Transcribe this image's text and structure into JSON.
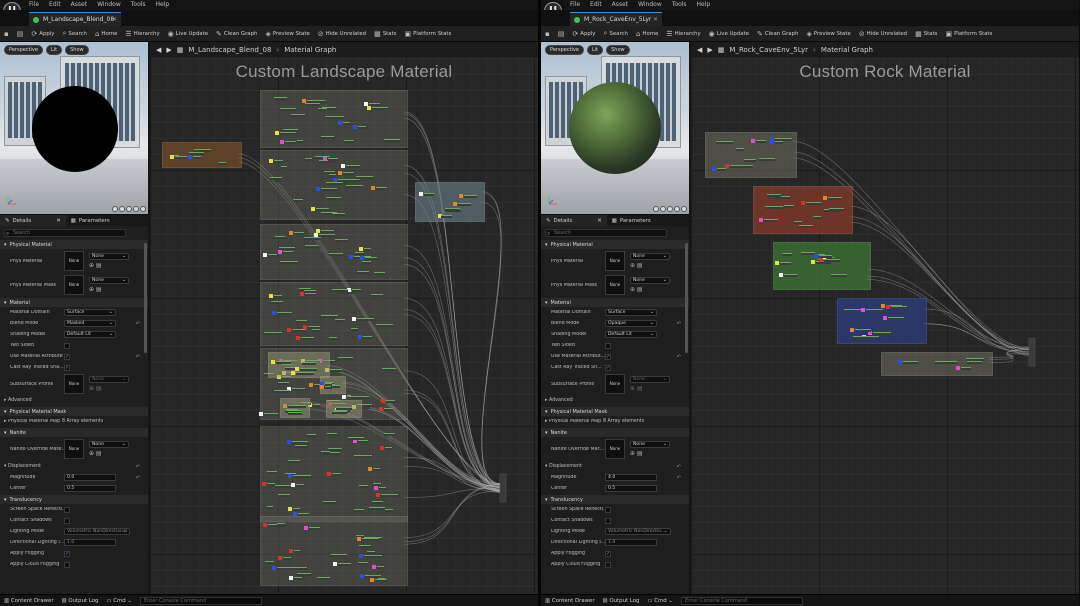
{
  "left": {
    "menu": [
      "File",
      "Edit",
      "Asset",
      "Window",
      "Tools",
      "Help"
    ],
    "tab_title": "M_Landscape_Blend_08",
    "toolbar": [
      "Apply",
      "Search",
      "Home",
      "Hierarchy",
      "Live Update",
      "Clean Graph",
      "Preview State",
      "Hide Unrelated",
      "Stats",
      "Platform Stats"
    ],
    "viewport": {
      "buttons": [
        "Perspective",
        "Lit",
        "Show"
      ],
      "preview": "black-sphere"
    },
    "breadcrumb": {
      "asset": "M_Landscape_Blend_08",
      "graph": "Material Graph"
    },
    "graph_title": "Custom Landscape Material",
    "details_tabs": [
      "Details",
      "Parameters"
    ],
    "search_placeholder": "Search",
    "details": {
      "physical_material": "Physical Material",
      "phys_material": "Phys Material",
      "phys_material_mask": "Phys Material Mask",
      "none": "None",
      "material": "Material",
      "material_domain": "Material Domain",
      "material_domain_val": "Surface",
      "blend_mode": "Blend Mode",
      "blend_mode_val": "Masked",
      "shading_model": "Shading Model",
      "shading_model_val": "Default Lit",
      "two_sided": "Two Sided",
      "use_mat_attr": "Use Material Attribute",
      "cast_ray": "Cast Ray Traced Sha...",
      "subsurface": "Subsurface Profile",
      "advanced": "Advanced",
      "phys_mask_sec": "Physical Material Mask",
      "phys_map": "Physical Material Map",
      "phys_map_val": "8 Array elements",
      "nanite": "Nanite",
      "nanite_override": "Nanite Override Mate...",
      "displacement": "Displacement",
      "magnitude": "Magnitude",
      "magnitude_val": "0.0",
      "center": "Center",
      "center_val": "0.5",
      "translucency": "Translucency",
      "ssr": "Screen Space Reflecti...",
      "contact_shadows": "Contact Shadows",
      "lighting_mode": "Lighting Mode",
      "lighting_mode_val": "Volumetric NonDirectional",
      "dir_lighting": "Directional Lighting I...",
      "dir_lighting_val": "1.0",
      "apply_fogging": "Apply Fogging",
      "apply_cloud": "Apply Cloud Fogging"
    },
    "status": {
      "content_drawer": "Content Drawer",
      "output_log": "Output Log",
      "cmd": "Cmd",
      "console": "Enter Console Command"
    }
  },
  "right": {
    "menu": [
      "File",
      "Edit",
      "Asset",
      "Window",
      "Tools",
      "Help"
    ],
    "tab_title": "M_Rock_CaveEnv_5Lyr",
    "toolbar": [
      "Apply",
      "Search",
      "Home",
      "Hierarchy",
      "Live Update",
      "Clean Graph",
      "Preview State",
      "Hide Unrelated",
      "Stats",
      "Platform Stats"
    ],
    "viewport": {
      "buttons": [
        "Perspective",
        "Lit",
        "Show"
      ],
      "preview": "rock-sphere"
    },
    "breadcrumb": {
      "asset": "M_Rock_CaveEnv_5Lyr",
      "graph": "Material Graph"
    },
    "graph_title": "Custom Rock Material",
    "details_tabs": [
      "Details",
      "Parameters"
    ],
    "search_placeholder": "Search",
    "details": {
      "physical_material": "Physical Material",
      "phys_material": "Phys Material",
      "phys_material_mask": "Phys Material Mask",
      "none": "None",
      "material": "Material",
      "material_domain": "Material Domain",
      "material_domain_val": "Surface",
      "blend_mode": "Blend Mode",
      "blend_mode_val": "Opaque",
      "shading_model": "Shading Model",
      "shading_model_val": "Default Lit",
      "two_sided": "Two Sided",
      "use_mat_attr": "Use Material Attribut...",
      "cast_ray": "Cast Ray Traced Sh...",
      "subsurface": "Subsurface Profile",
      "advanced": "Advanced",
      "phys_mask_sec": "Physical Material Mask",
      "phys_map": "Physical Material Map",
      "phys_map_val": "8 Array elements",
      "nanite": "Nanite",
      "nanite_override": "Nanite Override Mat...",
      "displacement": "Displacement",
      "magnitude": "Magnitude",
      "magnitude_val": "4.0",
      "center": "Center",
      "center_val": "0.5",
      "translucency": "Translucency",
      "ssr": "Screen Space Reflecti...",
      "contact_shadows": "Contact Shadows",
      "lighting_mode": "Lighting Mode",
      "lighting_mode_val": "Volumetric NonDirectio...",
      "dir_lighting": "Directional Lighting I...",
      "dir_lighting_val": "1.0",
      "apply_fogging": "Apply Fogging",
      "apply_cloud": "Apply Cloud Fogging"
    },
    "status": {
      "content_drawer": "Content Drawer",
      "output_log": "Output Log",
      "cmd": "Cmd",
      "console": "Enter Console Command"
    }
  },
  "colors": {
    "accent": "#3e8ede",
    "tab_dot": "#46c158",
    "comment_orange": "#8a5a2a",
    "comment_red": "#8c3a2c",
    "comment_green": "#3f7a35",
    "comment_blue": "#2e3f86",
    "comment_gray": "#6f6f62",
    "comment_teal": "#6b8088"
  }
}
